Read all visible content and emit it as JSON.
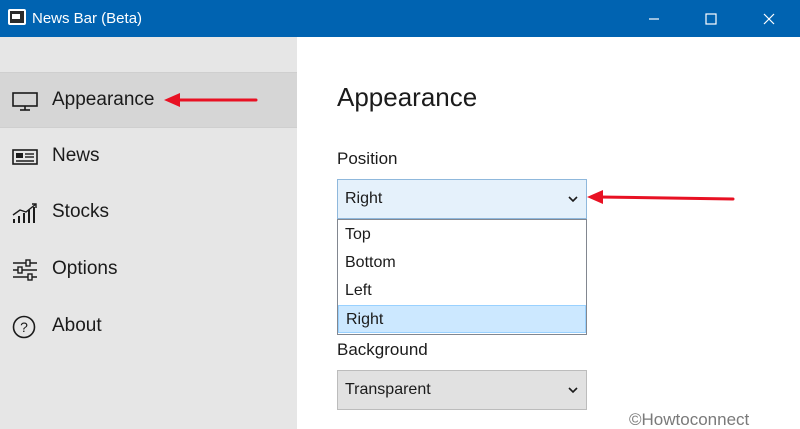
{
  "window": {
    "title": "News Bar (Beta)"
  },
  "sidebar": {
    "items": [
      {
        "label": "Appearance",
        "icon": "monitor-icon",
        "selected": true
      },
      {
        "label": "News",
        "icon": "newspaper-icon",
        "selected": false
      },
      {
        "label": "Stocks",
        "icon": "stocks-chart-icon",
        "selected": false
      },
      {
        "label": "Options",
        "icon": "sliders-icon",
        "selected": false
      },
      {
        "label": "About",
        "icon": "help-circle-icon",
        "selected": false
      }
    ]
  },
  "main": {
    "title": "Appearance",
    "position": {
      "label": "Position",
      "value": "Right",
      "options": [
        "Top",
        "Bottom",
        "Left",
        "Right"
      ],
      "selected_option": "Right"
    },
    "background": {
      "label": "Background",
      "value": "Transparent"
    }
  },
  "watermark": "©Howtoconnect",
  "colors": {
    "titlebar": "#0063b1",
    "sidebar": "#e6e6e6",
    "sidebar_selected": "#d6d6d6",
    "annotation_arrow": "#e81123",
    "dropdown_selected": "#cce8ff"
  }
}
